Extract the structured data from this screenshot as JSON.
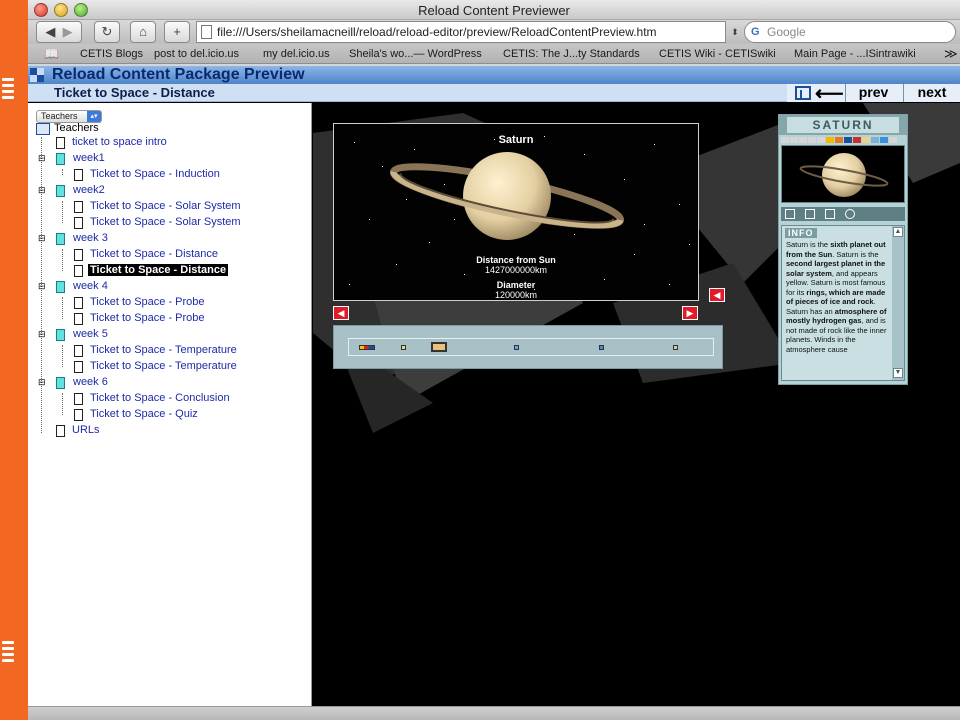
{
  "browser": {
    "window_title": "Reload Content Previewer",
    "url": "file:///Users/sheilamacneill/reload/reload-editor/preview/ReloadContentPreview.htm",
    "search_placeholder": "Google",
    "bookmarks": [
      "CETIS Blogs",
      "post to del.icio.us",
      "my del.icio.us",
      "Sheila's wo...— WordPress",
      "CETIS: The J...ty Standards",
      "CETIS Wiki - CETISwiki",
      "Main Page - ...ISintrawiki"
    ],
    "overflow": "≫"
  },
  "app": {
    "title": "Reload Content Package Preview",
    "page_name": "Ticket to Space - Distance",
    "nav": {
      "back_label": "⟵",
      "prev_label": "prev",
      "next_label": "next"
    }
  },
  "tree": {
    "role_selected": "Teachers",
    "root_label": "Teachers",
    "items": [
      "ticket to space intro",
      "week1",
      "Ticket to Space - Induction",
      "week2",
      "Ticket to Space - Solar System",
      "Ticket to Space - Solar System",
      "week 3",
      "Ticket to Space - Distance",
      "Ticket to Space - Distance",
      "week 4",
      "Ticket to Space - Probe",
      "Ticket to Space - Probe",
      "week 5",
      "Ticket to Space - Temperature",
      "Ticket to Space - Temperature",
      "week 6",
      "Ticket to Space - Conclusion",
      "Ticket to Space - Quiz",
      "URLs"
    ]
  },
  "viewer": {
    "planet_name": "Saturn",
    "distance_label": "Distance from Sun",
    "distance_value": "1427000000km",
    "diameter_label": "Diameter",
    "diameter_value": "120000km"
  },
  "info_panel": {
    "title": "SATURN",
    "section_label": "INFO",
    "text": [
      {
        "t": "Saturn is the ",
        "b": false
      },
      {
        "t": "sixth planet out from the Sun",
        "b": true
      },
      {
        "t": ". Saturn is the ",
        "b": false
      },
      {
        "t": "second largest planet in the solar system",
        "b": true
      },
      {
        "t": ", and appears yellow. Saturn is most famous for its ",
        "b": false
      },
      {
        "t": "rings, which are made of pieces of ice and rock",
        "b": true
      },
      {
        "t": ". Saturn has an ",
        "b": false
      },
      {
        "t": "atmosphere of mostly hydrogen gas",
        "b": true
      },
      {
        "t": ", and is not made of rock like the inner planets. Winds in the atmosphere cause",
        "b": false
      }
    ]
  },
  "colors": {
    "accent_orange": "#f26722",
    "header_blue": "#4f84c9",
    "tree_link": "#1e2aa8",
    "nav_red": "#e21b2a",
    "info_panel": "#b5d3d6"
  }
}
